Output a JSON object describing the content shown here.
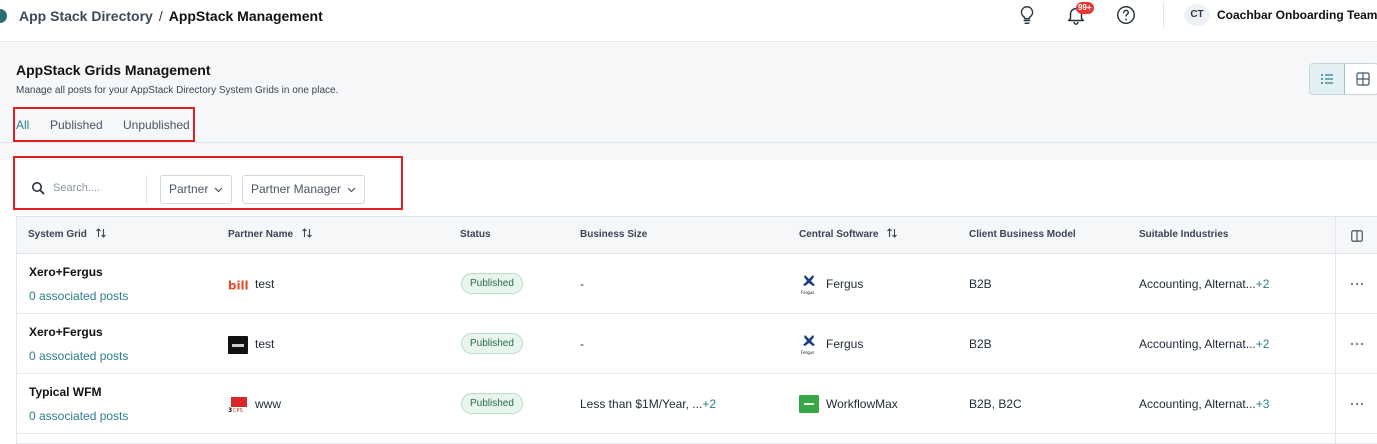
{
  "breadcrumb": {
    "parent": "App Stack Directory",
    "separator": "/",
    "current": "AppStack Management"
  },
  "header": {
    "icons": [
      "lightbulb-icon",
      "bell-icon",
      "help-icon"
    ],
    "notifications_badge": "99+",
    "user": {
      "initials": "CT",
      "name": "Coachbar Onboarding Team"
    }
  },
  "page": {
    "title": "AppStack Grids Management",
    "subtitle": "Manage all posts for your AppStack Directory System Grids in one place."
  },
  "tabs": [
    {
      "label": "All",
      "active": true
    },
    {
      "label": "Published",
      "active": false
    },
    {
      "label": "Unpublished",
      "active": false
    }
  ],
  "filters": {
    "search_placeholder": "Search....",
    "dropdowns": [
      "Partner",
      "Partner Manager"
    ]
  },
  "table": {
    "columns": [
      "System Grid",
      "Partner Name",
      "Status",
      "Business Size",
      "Central Software",
      "Client Business Model",
      "Suitable Industries"
    ],
    "rows": [
      {
        "grid": "Xero+Fergus",
        "assoc": "0 associated posts",
        "partner_logo": "bill-logo",
        "partner": "test",
        "status": "Published",
        "bsize": "-",
        "bsize_more": "",
        "software_logo": "fergus-logo",
        "software": "Fergus",
        "model": "B2B",
        "industries": "Accounting, Alternat...",
        "industries_more": "+2"
      },
      {
        "grid": "Xero+Fergus",
        "assoc": "0 associated posts",
        "partner_logo": "dark-logo",
        "partner": "test",
        "status": "Published",
        "bsize": "-",
        "bsize_more": "",
        "software_logo": "fergus-logo",
        "software": "Fergus",
        "model": "B2B",
        "industries": "Accounting, Alternat...",
        "industries_more": "+2"
      },
      {
        "grid": "Typical WFM",
        "assoc": "0 associated posts",
        "partner_logo": "3cps-logo",
        "partner": "www",
        "status": "Published",
        "bsize": "Less than $1M/Year, ...",
        "bsize_more": "+2",
        "software_logo": "workflowmax-logo",
        "software": "WorkflowMax",
        "model": "B2B, B2C",
        "industries": "Accounting, Alternat...",
        "industries_more": "+3"
      }
    ]
  },
  "colors": {
    "accent": "#2a7f8c",
    "highlight_box": "#e02020",
    "status_bg": "#e8f5ee",
    "badge": "#e53935"
  }
}
